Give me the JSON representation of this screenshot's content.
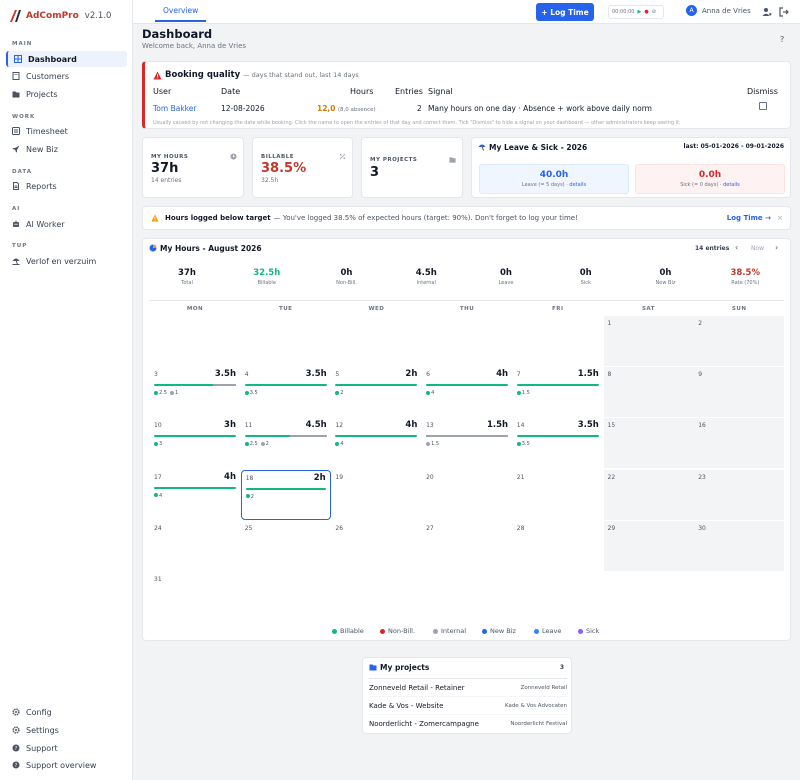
{
  "app": {
    "name": "AdComPro",
    "version": "v2.1.0"
  },
  "sidebar": {
    "sections": {
      "main": "MAIN",
      "work": "WORK",
      "data": "DATA",
      "ai": "AI",
      "tup": "TUP"
    },
    "items": [
      {
        "label": "Dashboard",
        "icon": "grid-icon"
      },
      {
        "label": "Customers",
        "icon": "building-icon"
      },
      {
        "label": "Projects",
        "icon": "folder-icon"
      },
      {
        "label": "Timesheet",
        "icon": "clock-icon"
      },
      {
        "label": "New Biz",
        "icon": "rocket-icon"
      },
      {
        "label": "Reports",
        "icon": "document-icon"
      },
      {
        "label": "AI Worker",
        "icon": "robot-icon"
      },
      {
        "label": "Verlof en verzuim",
        "icon": "beach-umbrella-icon"
      }
    ],
    "bottom": [
      {
        "label": "Config",
        "icon": "gear-icon"
      },
      {
        "label": "Settings",
        "icon": "gear-icon"
      },
      {
        "label": "Support",
        "icon": "question-icon"
      },
      {
        "label": "Support overview",
        "icon": "question-icon"
      }
    ]
  },
  "topbar": {
    "tab": "Overview",
    "log_time": "+ Log Time",
    "timer": "00:00:00",
    "user": "Anna de Vries",
    "avatar": "A"
  },
  "page": {
    "title": "Dashboard",
    "subtitle": "Welcome back, Anna de Vries",
    "help": "?"
  },
  "booking_quality": {
    "title": "Booking quality",
    "subtitle": "— days that stand out, last 14 days",
    "headers": {
      "user": "User",
      "date": "Date",
      "hours": "Hours",
      "entries": "Entries",
      "signal": "Signal",
      "dismiss": "Dismiss"
    },
    "row": {
      "user": "Tom Bakker",
      "date": "12-08-2026",
      "hours": "12,0",
      "absence": "(8,0 absence)",
      "entries": "2",
      "signal": "Many hours on one day · Absence + work above daily norm"
    },
    "footnote": "Usually caused by not changing the date while booking. Click the name to open the entries of that day and correct them. Tick \"Dismiss\" to hide a signal on your dashboard — other administrators keep seeing it."
  },
  "stats": {
    "my_hours": {
      "label": "MY HOURS",
      "value": "37h",
      "sub": "14 entries"
    },
    "billable": {
      "label": "BILLABLE",
      "value": "38.5%",
      "sub": "32.5h"
    },
    "my_projects": {
      "label": "MY PROJECTS",
      "value": "3"
    }
  },
  "leave": {
    "title": "My Leave & Sick - 2026",
    "last": "last: 05-01-2026 - 09-01-2026",
    "leave_value": "40.0h",
    "leave_label": "Leave (= 5 days) ·",
    "leave_link": "details",
    "sick_value": "0.0h",
    "sick_label": "Sick (= 0 days) ·",
    "sick_link": "details"
  },
  "warning": {
    "title": "Hours logged below target",
    "text": "— You've logged 38.5% of expected hours (target: 90%). Don't forget to log your time!",
    "link": "Log Time →",
    "close": "×"
  },
  "calendar": {
    "title": "My Hours - August 2026",
    "entries": "14 entries",
    "now": "Now",
    "summary": [
      {
        "value": "37h",
        "label": "Total",
        "color": "#111827"
      },
      {
        "value": "32.5h",
        "label": "Billable",
        "color": "#10b981"
      },
      {
        "value": "0h",
        "label": "Non-Bill.",
        "color": "#111827"
      },
      {
        "value": "4.5h",
        "label": "Internal",
        "color": "#111827"
      },
      {
        "value": "0h",
        "label": "Leave",
        "color": "#111827"
      },
      {
        "value": "0h",
        "label": "Sick",
        "color": "#111827"
      },
      {
        "value": "0h",
        "label": "New Biz",
        "color": "#111827"
      },
      {
        "value": "38.5%",
        "label": "Rate (70%)",
        "color": "#c0392b"
      }
    ],
    "weekdays": [
      "MON",
      "TUE",
      "WED",
      "THU",
      "FRI",
      "SAT",
      "SUN"
    ],
    "days": [
      {
        "n": "",
        "w": 0
      },
      {
        "n": "",
        "w": 0
      },
      {
        "n": "",
        "w": 0
      },
      {
        "n": "",
        "w": 0
      },
      {
        "n": "",
        "w": 0
      },
      {
        "n": "1",
        "w": 1
      },
      {
        "n": "2",
        "w": 1
      },
      {
        "n": "3",
        "h": "3.5h",
        "billable": 2.5,
        "internal": 1,
        "b": "2.5",
        "i": "1"
      },
      {
        "n": "4",
        "h": "3.5h",
        "billable": 3.5,
        "internal": 0,
        "b": "3.5"
      },
      {
        "n": "5",
        "h": "2h",
        "billable": 2,
        "internal": 0,
        "b": "2"
      },
      {
        "n": "6",
        "h": "4h",
        "billable": 4,
        "internal": 0,
        "b": "4"
      },
      {
        "n": "7",
        "h": "1.5h",
        "billable": 1.5,
        "internal": 0,
        "b": "1.5"
      },
      {
        "n": "8",
        "w": 1
      },
      {
        "n": "9",
        "w": 1
      },
      {
        "n": "10",
        "h": "3h",
        "billable": 3,
        "internal": 0,
        "b": "3"
      },
      {
        "n": "11",
        "h": "4.5h",
        "billable": 2.5,
        "internal": 2,
        "b": "2.5",
        "i": "2"
      },
      {
        "n": "12",
        "h": "4h",
        "billable": 4,
        "internal": 0,
        "b": "4"
      },
      {
        "n": "13",
        "h": "1.5h",
        "billable": 0,
        "internal": 1.5,
        "i": "1.5"
      },
      {
        "n": "14",
        "h": "3.5h",
        "billable": 3.5,
        "internal": 0,
        "b": "3.5"
      },
      {
        "n": "15",
        "w": 1
      },
      {
        "n": "16",
        "w": 1
      },
      {
        "n": "17",
        "h": "4h",
        "billable": 4,
        "internal": 0,
        "b": "4"
      },
      {
        "n": "18",
        "h": "2h",
        "billable": 2,
        "internal": 0,
        "b": "2",
        "sel": 1
      },
      {
        "n": "19"
      },
      {
        "n": "20"
      },
      {
        "n": "21"
      },
      {
        "n": "22",
        "w": 1
      },
      {
        "n": "23",
        "w": 1
      },
      {
        "n": "24"
      },
      {
        "n": "25"
      },
      {
        "n": "26"
      },
      {
        "n": "27"
      },
      {
        "n": "28"
      },
      {
        "n": "29",
        "w": 1
      },
      {
        "n": "30",
        "w": 1
      },
      {
        "n": "31"
      }
    ],
    "legend": [
      {
        "label": "Billable",
        "color": "#10b981"
      },
      {
        "label": "Non-Bill.",
        "color": "#dc2626"
      },
      {
        "label": "Internal",
        "color": "#9ca3af"
      },
      {
        "label": "New Biz",
        "color": "#2563eb"
      },
      {
        "label": "Leave",
        "color": "#3b82f6"
      },
      {
        "label": "Sick",
        "color": "#8b5cf6"
      }
    ]
  },
  "projects": {
    "title": "My projects",
    "count": "3",
    "items": [
      {
        "name": "Zonneveld Retail - Retainer",
        "client": "Zonneveld Retail"
      },
      {
        "name": "Kade & Vos - Website",
        "client": "Kade & Vos Advocaten"
      },
      {
        "name": "Noorderlicht - Zomercampagne",
        "client": "Noorderlicht Festival"
      }
    ]
  },
  "colors": {
    "accent": "#2563eb",
    "brand": "#c0392b",
    "billable": "#10b981",
    "internal": "#9ca3af",
    "danger": "#dc2626"
  }
}
